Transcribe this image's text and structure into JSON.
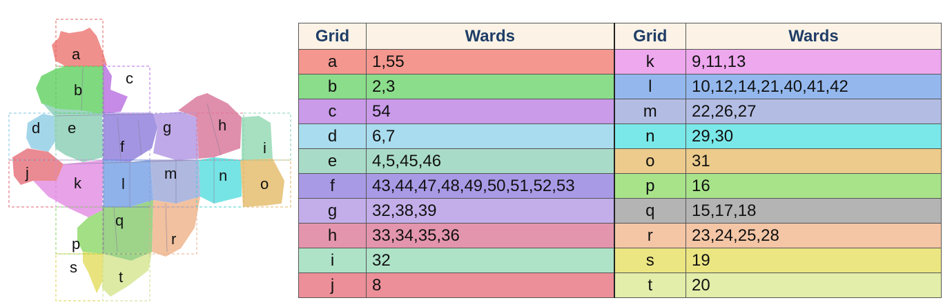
{
  "map": {
    "grid_labels": [
      "a",
      "b",
      "c",
      "d",
      "e",
      "f",
      "g",
      "h",
      "i",
      "j",
      "k",
      "l",
      "m",
      "n",
      "o",
      "p",
      "q",
      "r",
      "s",
      "t"
    ]
  },
  "table": {
    "headers": [
      "Grid",
      "Wards",
      "Grid",
      "Wards"
    ],
    "left_rows": [
      {
        "grid": "a",
        "wards": "1,55",
        "color": "#f4978e"
      },
      {
        "grid": "b",
        "wards": "2,3",
        "color": "#8bdd8b"
      },
      {
        "grid": "c",
        "wards": "54",
        "color": "#c99be8"
      },
      {
        "grid": "d",
        "wards": "6,7",
        "color": "#a9dcee"
      },
      {
        "grid": "e",
        "wards": "4,5,45,46",
        "color": "#a9dcc8"
      },
      {
        "grid": "f",
        "wards": "43,44,47,48,49,50,51,52,53",
        "color": "#a99ae6"
      },
      {
        "grid": "g",
        "wards": "32,38,39",
        "color": "#c3aeea"
      },
      {
        "grid": "h",
        "wards": "33,34,35,36",
        "color": "#e495ae"
      },
      {
        "grid": "i",
        "wards": "32",
        "color": "#aee3c8"
      },
      {
        "grid": "j",
        "wards": "8",
        "color": "#ec8f98"
      }
    ],
    "right_rows": [
      {
        "grid": "k",
        "wards": "9,11,13",
        "color": "#eea8ee"
      },
      {
        "grid": "l",
        "wards": "10,12,14,21,40,41,42",
        "color": "#94b8ee"
      },
      {
        "grid": "m",
        "wards": "22,26,27",
        "color": "#b3bde4"
      },
      {
        "grid": "n",
        "wards": "29,30",
        "color": "#7ae8e8"
      },
      {
        "grid": "o",
        "wards": "31",
        "color": "#eccb8c"
      },
      {
        "grid": "p",
        "wards": "16",
        "color": "#a8e38a"
      },
      {
        "grid": "q",
        "wards": "15,17,18",
        "color": "#b4b4b4"
      },
      {
        "grid": "r",
        "wards": "23,24,25,28",
        "color": "#f4c6a6"
      },
      {
        "grid": "s",
        "wards": "19",
        "color": "#ebe682"
      },
      {
        "grid": "t",
        "wards": "20",
        "color": "#e2eeaa"
      }
    ]
  }
}
